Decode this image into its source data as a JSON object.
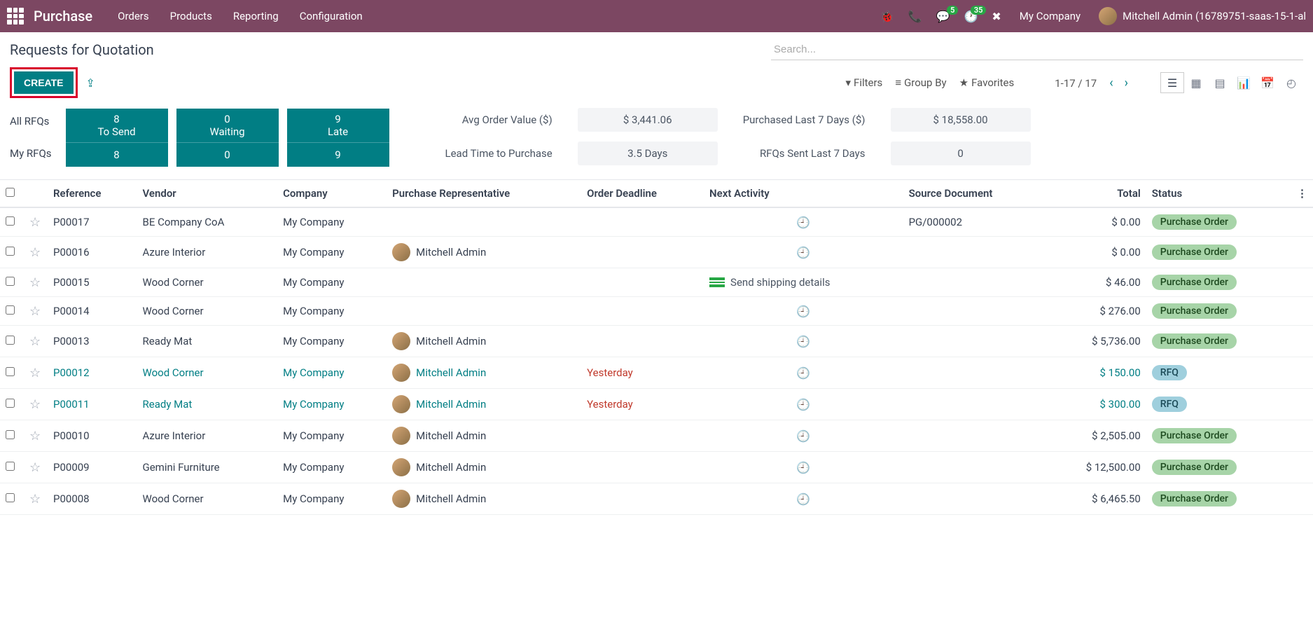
{
  "navbar": {
    "brand": "Purchase",
    "menu": [
      "Orders",
      "Products",
      "Reporting",
      "Configuration"
    ],
    "messaging_badge": "5",
    "activities_badge": "35",
    "company": "My Company",
    "user": "Mitchell Admin (16789751-saas-15-1-al"
  },
  "cp": {
    "title": "Requests for Quotation",
    "create": "CREATE",
    "search_placeholder": "Search...",
    "filters": "Filters",
    "groupby": "Group By",
    "favorites": "Favorites",
    "pager": "1-17 / 17"
  },
  "dash": {
    "row_labels": [
      "All RFQs",
      "My RFQs"
    ],
    "tiles": [
      {
        "top_num": "8",
        "top_lbl": "To Send",
        "bot": "8"
      },
      {
        "top_num": "0",
        "top_lbl": "Waiting",
        "bot": "0"
      },
      {
        "top_num": "9",
        "top_lbl": "Late",
        "bot": "9"
      }
    ],
    "metrics": [
      {
        "label": "Avg Order Value ($)",
        "value": "$ 3,441.06"
      },
      {
        "label": "Purchased Last 7 Days ($)",
        "value": "$ 18,558.00"
      },
      {
        "label": "Lead Time to Purchase",
        "value": "3.5  Days"
      },
      {
        "label": "RFQs Sent Last 7 Days",
        "value": "0"
      }
    ]
  },
  "columns": [
    "Reference",
    "Vendor",
    "Company",
    "Purchase Representative",
    "Order Deadline",
    "Next Activity",
    "Source Document",
    "Total",
    "Status"
  ],
  "rows": [
    {
      "ref": "P00017",
      "vendor": "BE Company CoA",
      "company": "My Company",
      "rep": "",
      "deadline": "",
      "activity": "clock",
      "src": "PG/000002",
      "total": "$ 0.00",
      "status": "Purchase Order",
      "status_cls": "po",
      "link": false
    },
    {
      "ref": "P00016",
      "vendor": "Azure Interior",
      "company": "My Company",
      "rep": "Mitchell Admin",
      "deadline": "",
      "activity": "clock",
      "src": "",
      "total": "$ 0.00",
      "status": "Purchase Order",
      "status_cls": "po",
      "link": false
    },
    {
      "ref": "P00015",
      "vendor": "Wood Corner",
      "company": "My Company",
      "rep": "",
      "deadline": "",
      "activity": "send",
      "activity_text": "Send shipping details",
      "src": "",
      "total": "$ 46.00",
      "status": "Purchase Order",
      "status_cls": "po",
      "link": false
    },
    {
      "ref": "P00014",
      "vendor": "Wood Corner",
      "company": "My Company",
      "rep": "",
      "deadline": "",
      "activity": "clock",
      "src": "",
      "total": "$ 276.00",
      "status": "Purchase Order",
      "status_cls": "po",
      "link": false
    },
    {
      "ref": "P00013",
      "vendor": "Ready Mat",
      "company": "My Company",
      "rep": "Mitchell Admin",
      "deadline": "",
      "activity": "clock",
      "src": "",
      "total": "$ 5,736.00",
      "status": "Purchase Order",
      "status_cls": "po",
      "link": false
    },
    {
      "ref": "P00012",
      "vendor": "Wood Corner",
      "company": "My Company",
      "rep": "Mitchell Admin",
      "deadline": "Yesterday",
      "activity": "clock",
      "src": "",
      "total": "$ 150.00",
      "status": "RFQ",
      "status_cls": "rfq",
      "link": true
    },
    {
      "ref": "P00011",
      "vendor": "Ready Mat",
      "company": "My Company",
      "rep": "Mitchell Admin",
      "deadline": "Yesterday",
      "activity": "clock",
      "src": "",
      "total": "$ 300.00",
      "status": "RFQ",
      "status_cls": "rfq",
      "link": true
    },
    {
      "ref": "P00010",
      "vendor": "Azure Interior",
      "company": "My Company",
      "rep": "Mitchell Admin",
      "deadline": "",
      "activity": "clock",
      "src": "",
      "total": "$ 2,505.00",
      "status": "Purchase Order",
      "status_cls": "po",
      "link": false
    },
    {
      "ref": "P00009",
      "vendor": "Gemini Furniture",
      "company": "My Company",
      "rep": "Mitchell Admin",
      "deadline": "",
      "activity": "clock",
      "src": "",
      "total": "$ 12,500.00",
      "status": "Purchase Order",
      "status_cls": "po",
      "link": false
    },
    {
      "ref": "P00008",
      "vendor": "Wood Corner",
      "company": "My Company",
      "rep": "Mitchell Admin",
      "deadline": "",
      "activity": "clock",
      "src": "",
      "total": "$ 6,465.50",
      "status": "Purchase Order",
      "status_cls": "po",
      "link": false
    }
  ]
}
